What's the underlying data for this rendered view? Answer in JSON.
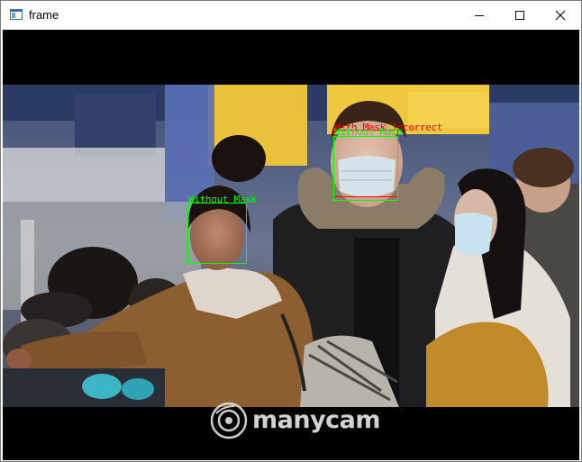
{
  "window": {
    "title": "frame",
    "controls": {
      "minimize": "minimize-icon",
      "maximize": "maximize-icon",
      "close": "close-icon"
    }
  },
  "detections": [
    {
      "label": "With Mask Incorrect",
      "color": "#ff0000"
    },
    {
      "label": "Without Mask",
      "color": "#00ff00"
    },
    {
      "label": "Without Mask",
      "color": "#00ff00"
    }
  ],
  "watermark": {
    "text": "manycam",
    "logo": "manycam-logo-icon"
  }
}
